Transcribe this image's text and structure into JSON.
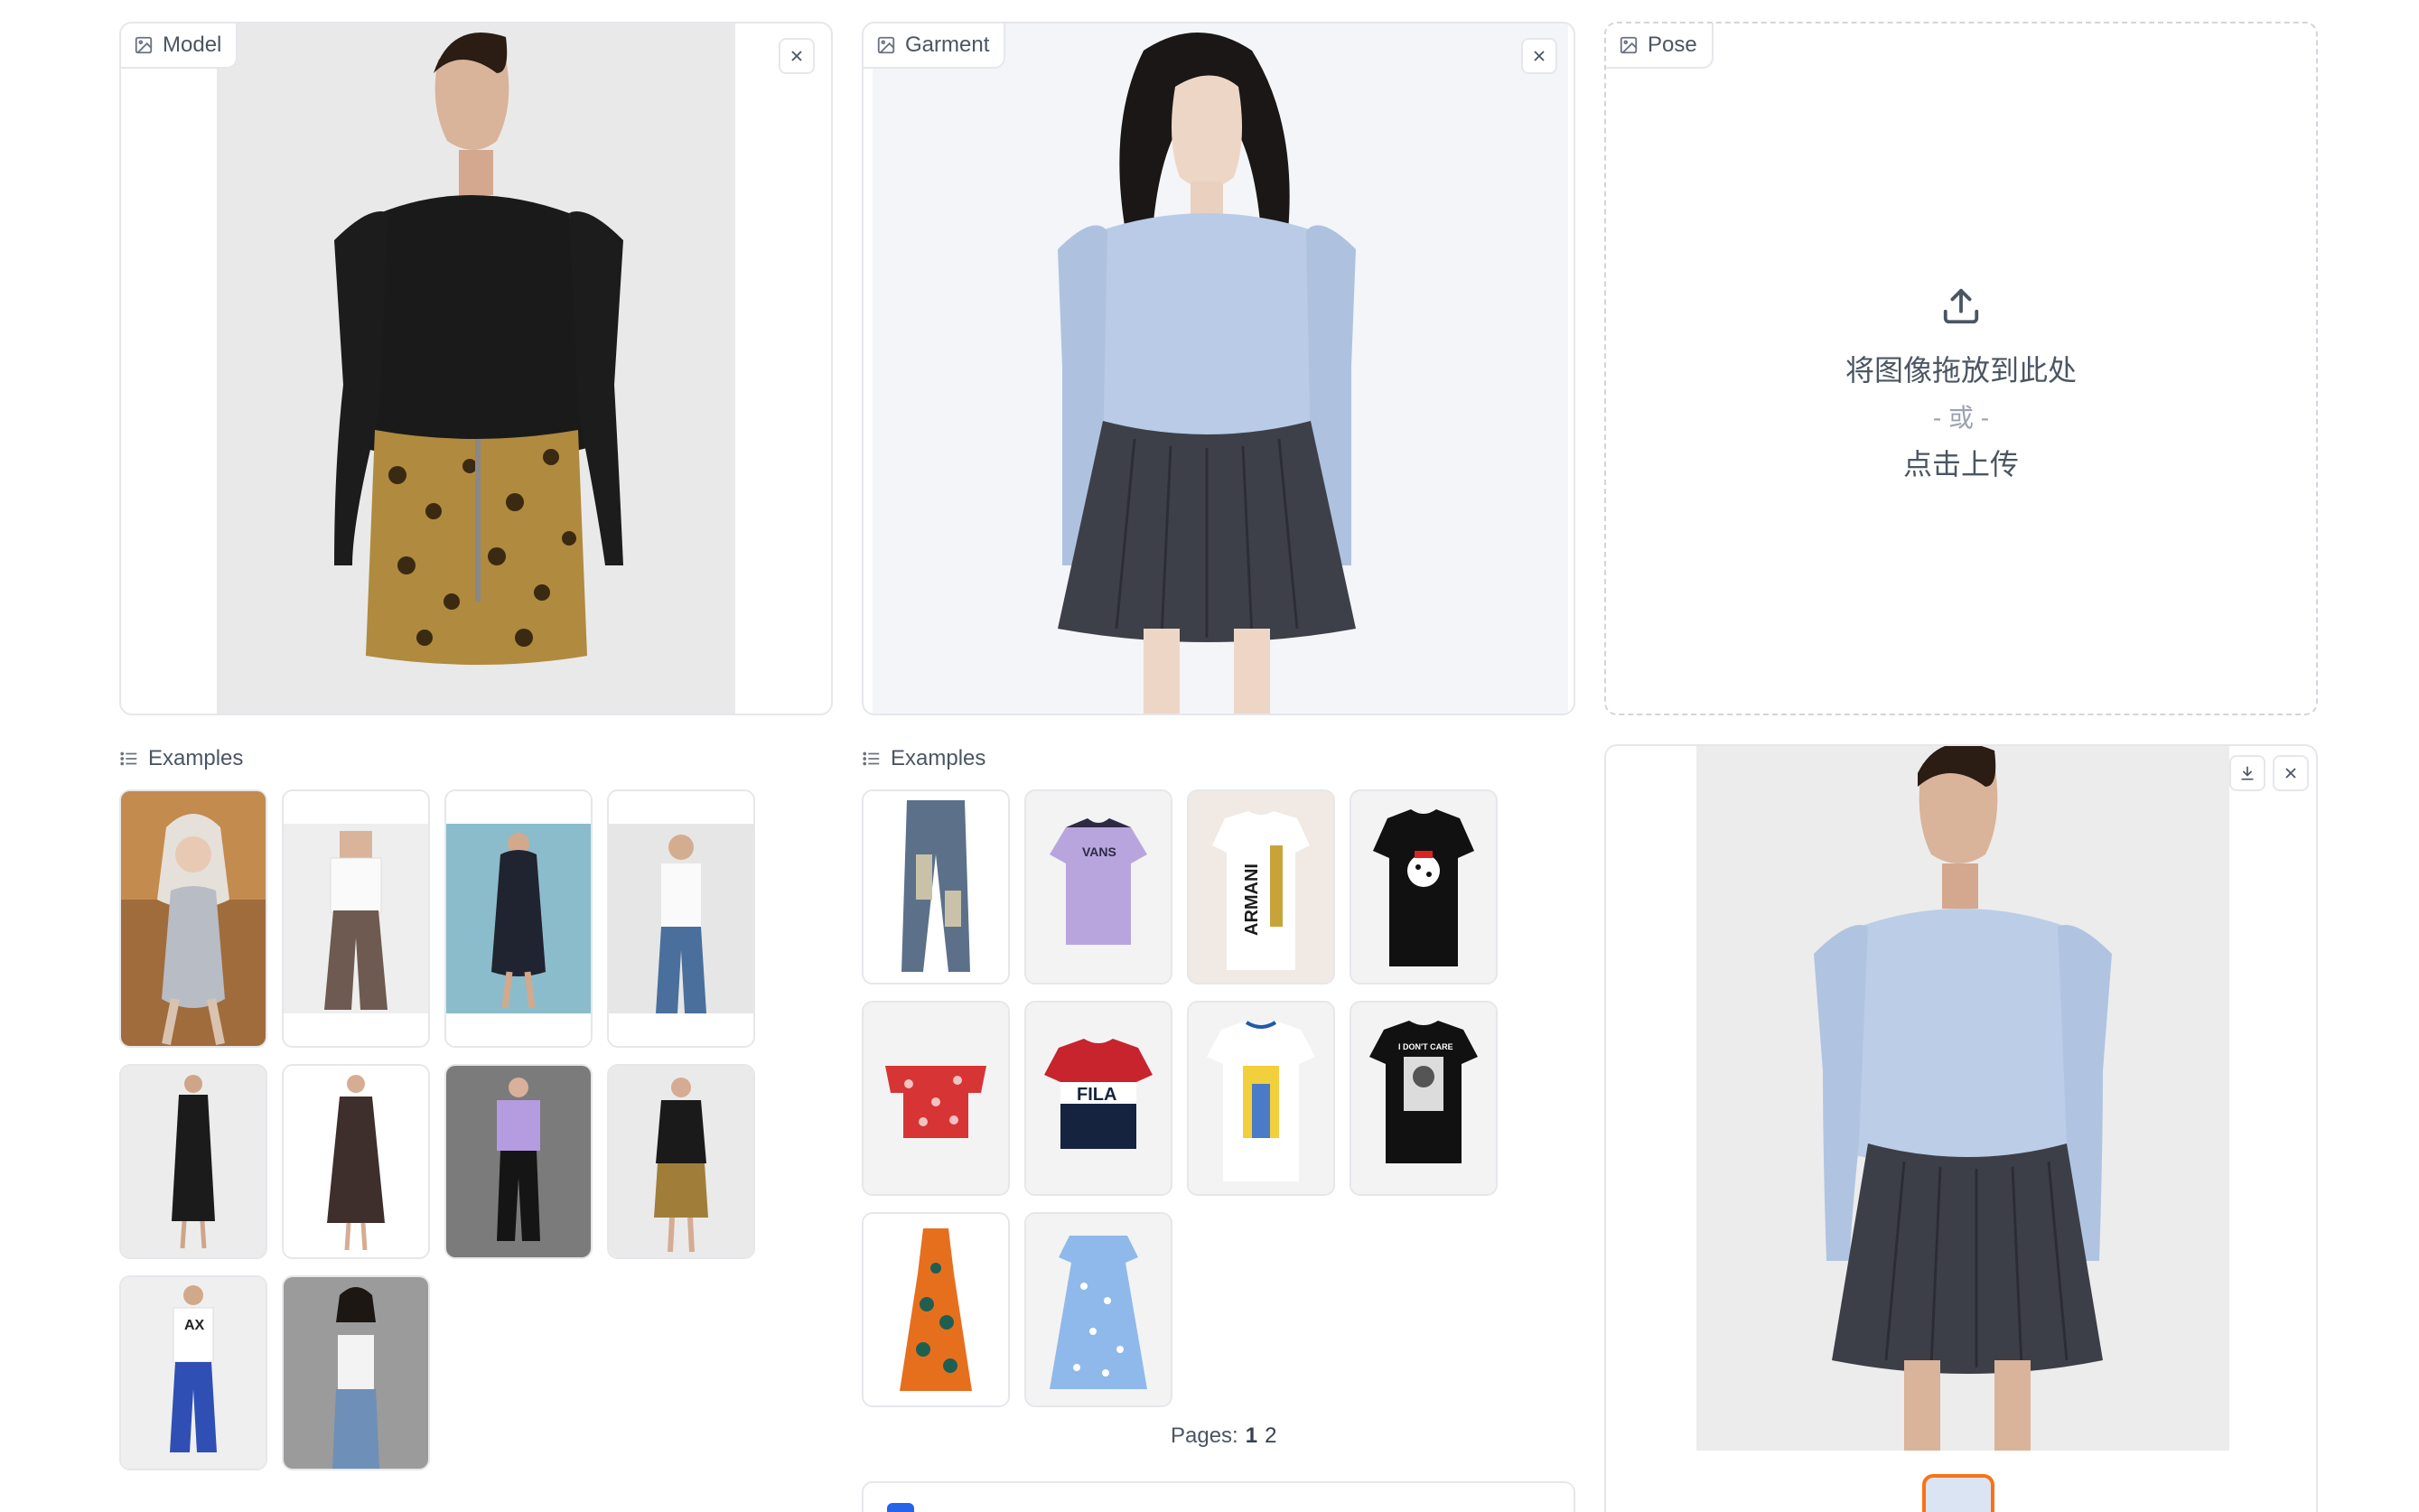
{
  "model_panel": {
    "label": "Model",
    "icon": "image-icon",
    "clear_icon": "close-icon"
  },
  "garment_panel": {
    "label": "Garment",
    "icon": "image-icon",
    "clear_icon": "close-icon"
  },
  "pose_panel": {
    "label": "Pose",
    "icon": "image-icon",
    "upload_icon": "upload-icon",
    "drop_text": "将图像拖放到此处",
    "or_text": "- 或 -",
    "click_text": "点击上传"
  },
  "model_examples": {
    "heading": "Examples",
    "icon": "list-icon",
    "items": [
      {
        "name": "model-example-1"
      },
      {
        "name": "model-example-2"
      },
      {
        "name": "model-example-3"
      },
      {
        "name": "model-example-4"
      },
      {
        "name": "model-example-5"
      },
      {
        "name": "model-example-6"
      },
      {
        "name": "model-example-7"
      },
      {
        "name": "model-example-8"
      },
      {
        "name": "model-example-9"
      },
      {
        "name": "model-example-10"
      }
    ]
  },
  "garment_examples": {
    "heading": "Examples",
    "icon": "list-icon",
    "items": [
      {
        "name": "garment-jeans"
      },
      {
        "name": "garment-vans-tee",
        "print": "VANS"
      },
      {
        "name": "garment-armani-tee",
        "print": "ARMANI"
      },
      {
        "name": "garment-dalmatian-tee"
      },
      {
        "name": "garment-red-floral-top"
      },
      {
        "name": "garment-fila-tee",
        "print": "FILA"
      },
      {
        "name": "garment-graphic-tee"
      },
      {
        "name": "garment-dont-care-tee",
        "print": "I DON'T CARE"
      },
      {
        "name": "garment-orange-dress"
      },
      {
        "name": "garment-blue-floral-dress"
      }
    ],
    "pages_label": "Pages:",
    "pages": [
      "1",
      "2"
    ]
  },
  "output_panel": {
    "download_icon": "download-icon",
    "clear_icon": "close-icon"
  },
  "colors": {
    "accent": "#f97316",
    "border": "#e5e7eb",
    "blue": "#2563eb"
  }
}
